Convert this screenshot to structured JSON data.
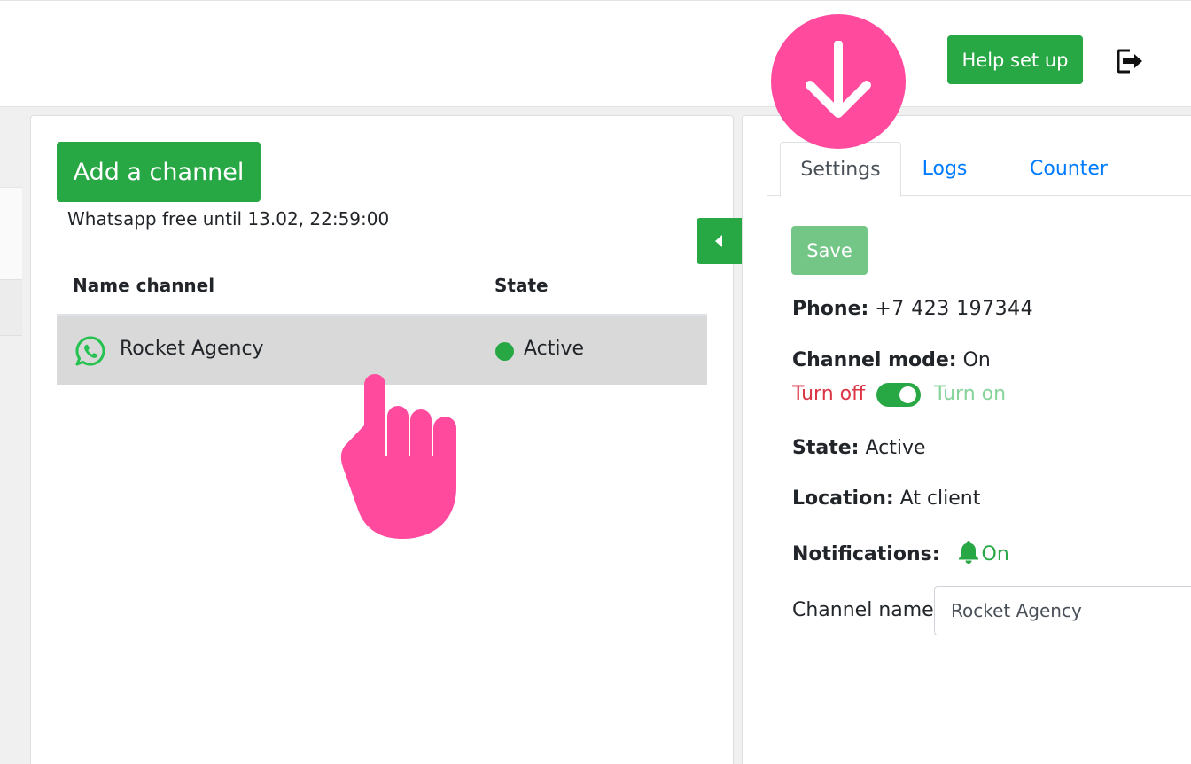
{
  "header": {
    "help_label": "Help set up",
    "logout_icon": "logout-icon"
  },
  "channels": {
    "add_label": "Add a channel",
    "free_note": "Whatsapp free until 13.02, 22:59:00",
    "columns": [
      "Name channel",
      "State"
    ],
    "rows": [
      {
        "name": "Rocket Agency",
        "state": "Active",
        "icon": "whatsapp-icon",
        "status_color": "#28a745"
      }
    ]
  },
  "settings": {
    "tabs": [
      "Settings",
      "Logs",
      "Counter"
    ],
    "active_tab": "Settings",
    "save_label": "Save",
    "phone_label": "Phone:",
    "phone_value": "+7 423 197344",
    "mode_label": "Channel mode:",
    "mode_value": "On",
    "turn_off_label": "Turn off",
    "turn_on_label": "Turn on",
    "toggle_on": true,
    "state_label": "State:",
    "state_value": "Active",
    "location_label": "Location:",
    "location_value": "At client",
    "notifications_label": "Notifications:",
    "notifications_value": "On",
    "channel_name_label": "Channel name",
    "channel_name_value": "Rocket Agency"
  },
  "colors": {
    "accent": "#28a745",
    "link": "#007bff",
    "danger": "#dc3545",
    "overlay": "#ff4a9e"
  }
}
